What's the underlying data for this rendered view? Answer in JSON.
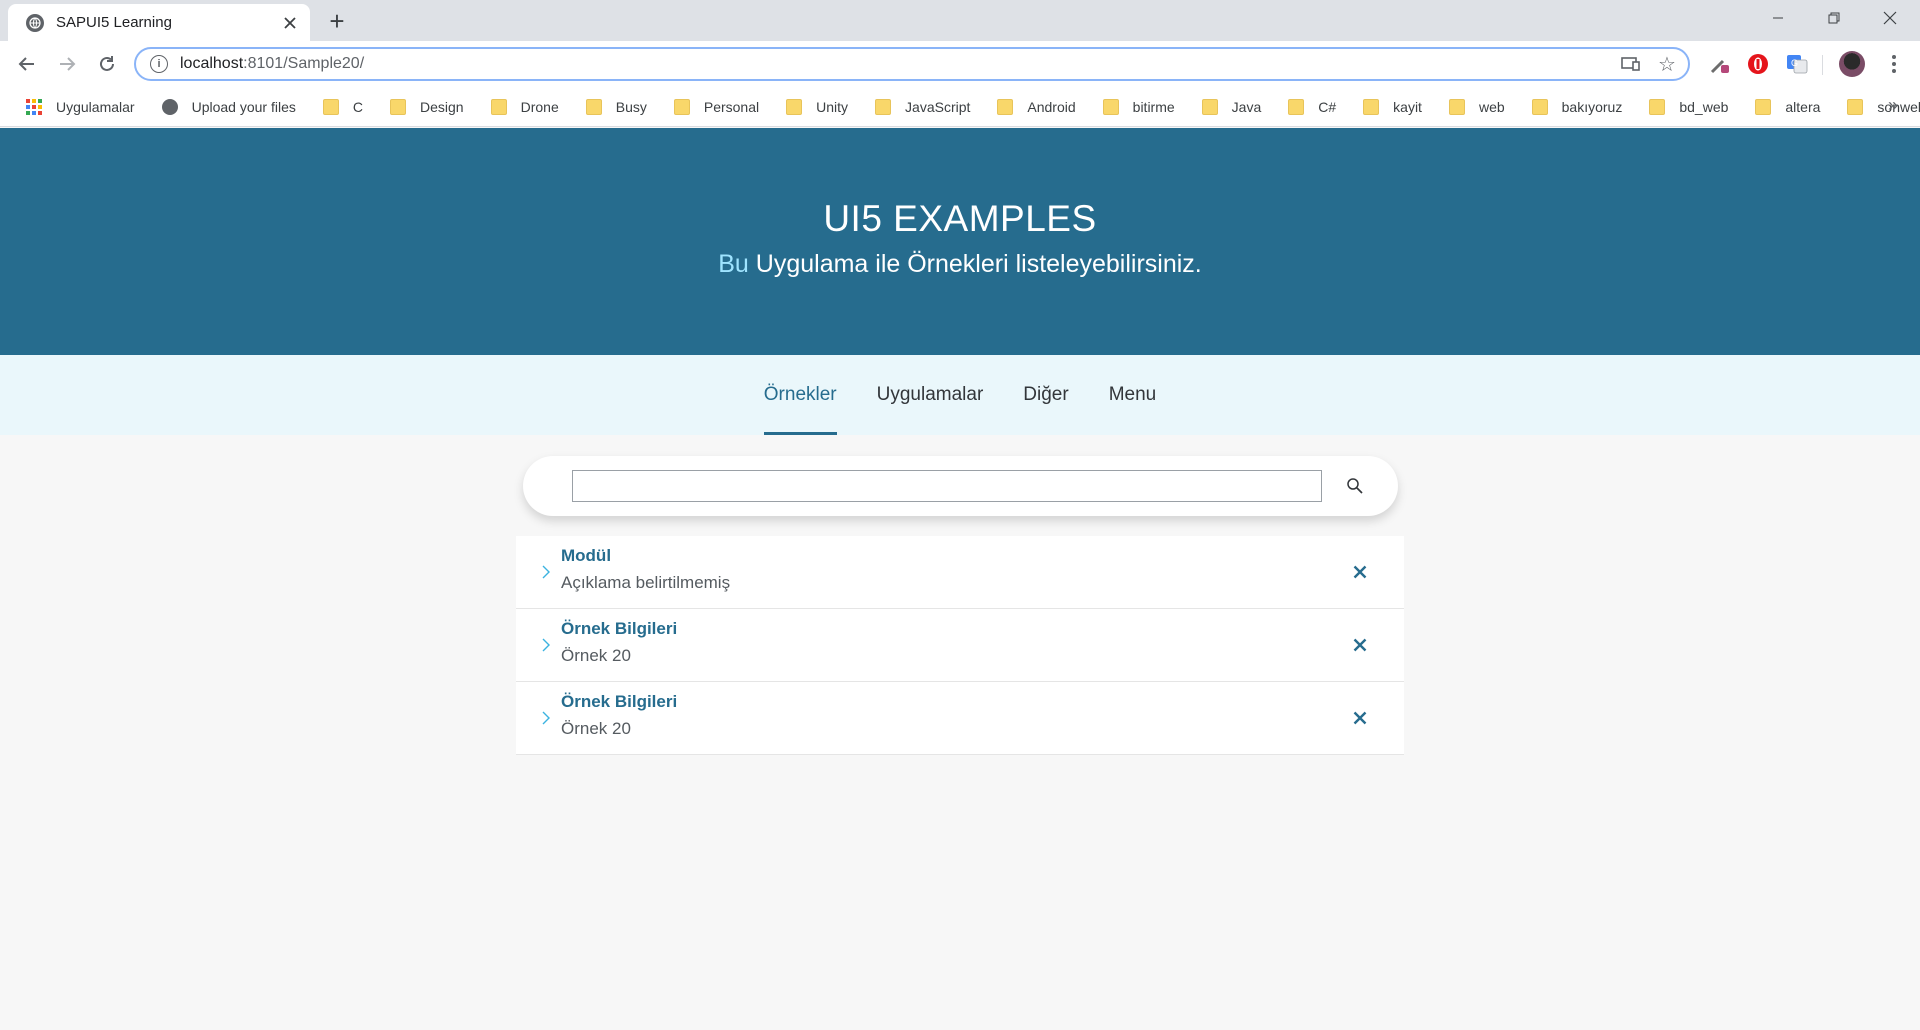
{
  "browser": {
    "tab_title": "SAPUI5 Learning",
    "tab_favicon": "globe-icon",
    "new_tab_label": "+",
    "url_host": "localhost",
    "url_path": ":8101/Sample20/",
    "bookmarks": [
      {
        "label": "Uygulamalar",
        "icon": "apps-grid-icon"
      },
      {
        "label": "Upload your files",
        "icon": "globe-icon"
      },
      {
        "label": "C",
        "icon": "folder-icon"
      },
      {
        "label": "Design",
        "icon": "folder-icon"
      },
      {
        "label": "Drone",
        "icon": "folder-icon"
      },
      {
        "label": "Busy",
        "icon": "folder-icon"
      },
      {
        "label": "Personal",
        "icon": "folder-icon"
      },
      {
        "label": "Unity",
        "icon": "folder-icon"
      },
      {
        "label": "JavaScript",
        "icon": "folder-icon"
      },
      {
        "label": "Android",
        "icon": "folder-icon"
      },
      {
        "label": "bitirme",
        "icon": "folder-icon"
      },
      {
        "label": "Java",
        "icon": "folder-icon"
      },
      {
        "label": "C#",
        "icon": "folder-icon"
      },
      {
        "label": "kayit",
        "icon": "folder-icon"
      },
      {
        "label": "web",
        "icon": "folder-icon"
      },
      {
        "label": "bakıyoruz",
        "icon": "folder-icon"
      },
      {
        "label": "bd_web",
        "icon": "folder-icon"
      },
      {
        "label": "altera",
        "icon": "folder-icon"
      },
      {
        "label": "sonweb",
        "icon": "folder-icon"
      }
    ],
    "bookmarks_more": "»"
  },
  "app": {
    "header": {
      "title": "UI5 EXAMPLES",
      "subtitle_highlight": "Bu",
      "subtitle_rest": " Uygulama ile Örnekleri listeleyebilirsiniz."
    },
    "tabs": [
      {
        "label": "Örnekler",
        "active": true
      },
      {
        "label": "Uygulamalar",
        "active": false
      },
      {
        "label": "Diğer",
        "active": false
      },
      {
        "label": "Menu",
        "active": false
      }
    ],
    "search": {
      "value": "",
      "placeholder": ""
    },
    "list_items": [
      {
        "title": "Modül",
        "description": "Açıklama belirtilmemiş"
      },
      {
        "title": "Örnek Bilgileri",
        "description": "Örnek 20"
      },
      {
        "title": "Örnek Bilgileri",
        "description": "Örnek 20"
      }
    ]
  },
  "colors": {
    "header_bg": "#266c8e",
    "tabs_bg": "#eaf7fb",
    "accent": "#266c8e",
    "subtitle_highlight": "#9fe4ff"
  }
}
